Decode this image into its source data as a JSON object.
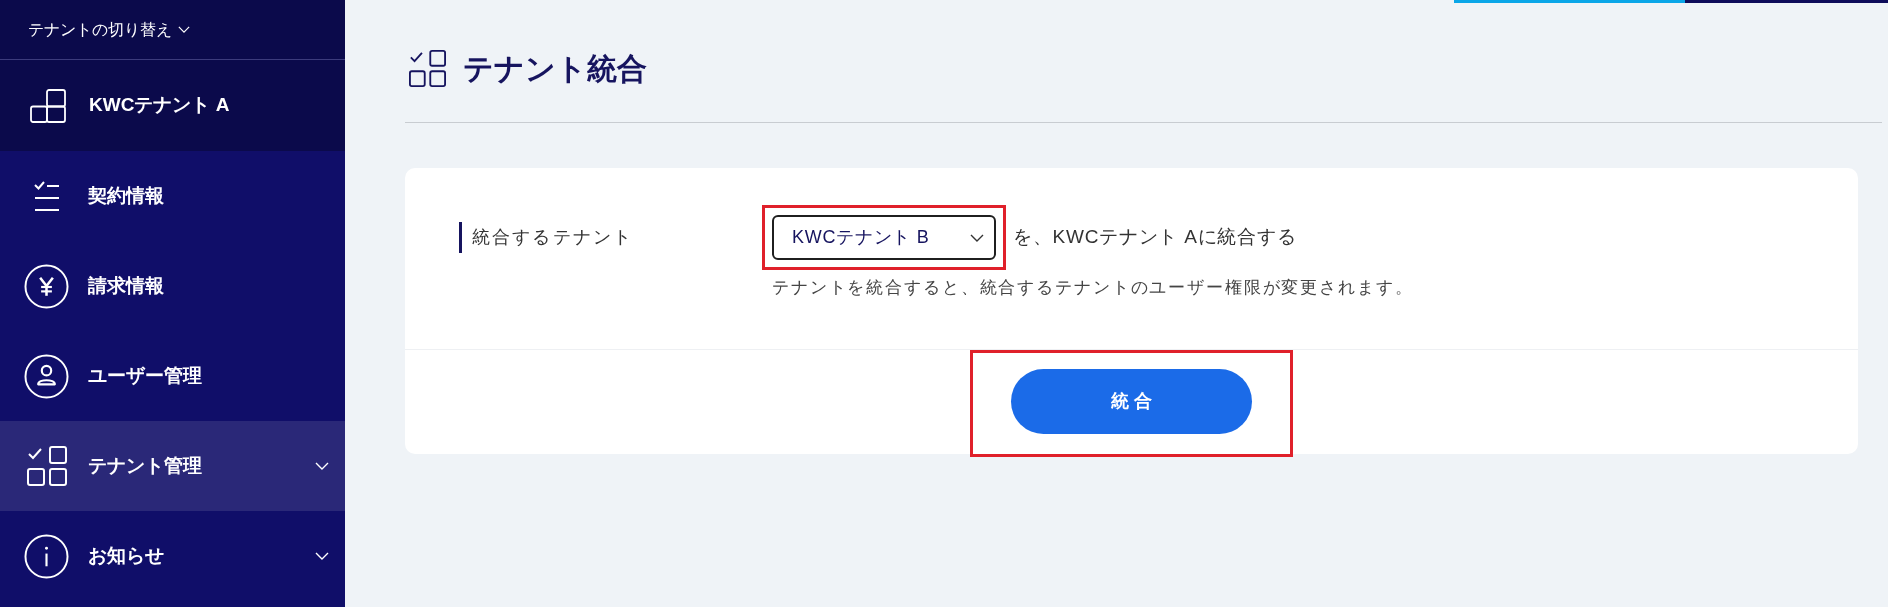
{
  "sidebar": {
    "tenant_switcher": {
      "label": "テナントの切り替え"
    },
    "current_tenant": {
      "name": "KWCテナント A"
    },
    "items": [
      {
        "label": "契約情報",
        "kind": "checklist",
        "selected": false,
        "has_submenu": false
      },
      {
        "label": "請求情報",
        "kind": "yen",
        "selected": false,
        "has_submenu": false
      },
      {
        "label": "ユーザー管理",
        "kind": "user",
        "selected": false,
        "has_submenu": false
      },
      {
        "label": "テナント管理",
        "kind": "tenant",
        "selected": true,
        "has_submenu": true
      },
      {
        "label": "お知らせ",
        "kind": "info",
        "selected": false,
        "has_submenu": true
      }
    ]
  },
  "page": {
    "title": "テナント統合"
  },
  "form": {
    "field_label": "統合するテナント",
    "tenant_select": {
      "value": "KWCテナント B",
      "highlighted": true
    },
    "suffix": "を、KWCテナント Aに統合する",
    "note": "テナントを統合すると、統合するテナントのユーザー権限が変更されます。"
  },
  "merge_button": {
    "label": "統合",
    "highlighted": true
  }
}
